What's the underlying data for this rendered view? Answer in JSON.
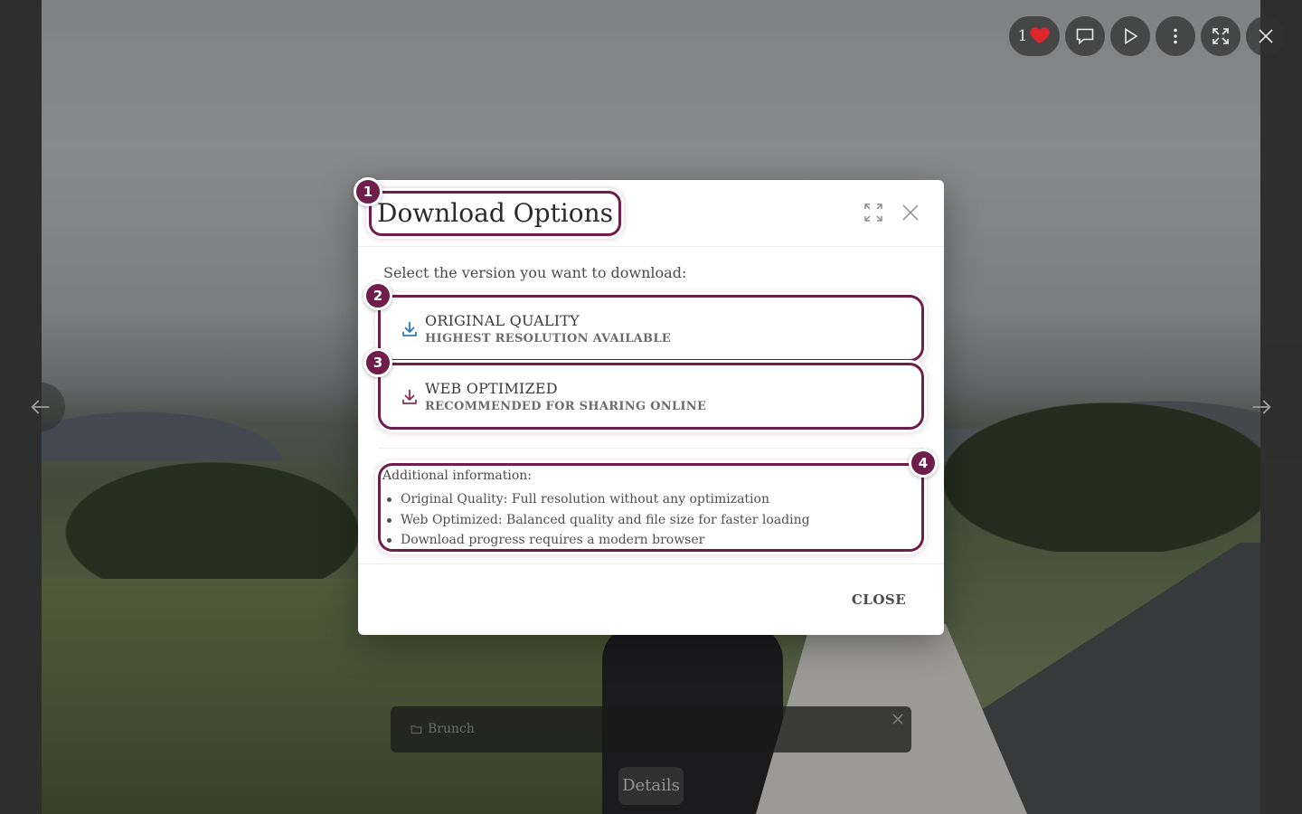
{
  "background": {
    "album_name": "Brunch",
    "details_label": "Details"
  },
  "toolbar": {
    "like_count": "1",
    "icons": [
      "heart-icon",
      "comment-icon",
      "play-icon",
      "more-icon",
      "fullscreen-icon",
      "close-icon"
    ]
  },
  "modal": {
    "title": "Download Options",
    "subtitle": "Select the version you want to download:",
    "options": [
      {
        "title": "ORIGINAL QUALITY",
        "subtitle": "HIGHEST RESOLUTION AVAILABLE",
        "icon": "download-icon",
        "icon_color": "#2b78c5"
      },
      {
        "title": "WEB OPTIMIZED",
        "subtitle": "RECOMMENDED FOR SHARING ONLINE",
        "icon": "download-icon",
        "icon_color": "#8a2d5b"
      }
    ],
    "info_title": "Additional information:",
    "info_items": [
      "Original Quality: Full resolution without any optimization",
      "Web Optimized: Balanced quality and file size for faster loading",
      "Download progress requires a modern browser"
    ],
    "close_label": "CLOSE"
  },
  "markers": [
    "1",
    "2",
    "3",
    "4"
  ],
  "colors": {
    "accent": "#6f1d4a",
    "heart": "#e0242c"
  }
}
